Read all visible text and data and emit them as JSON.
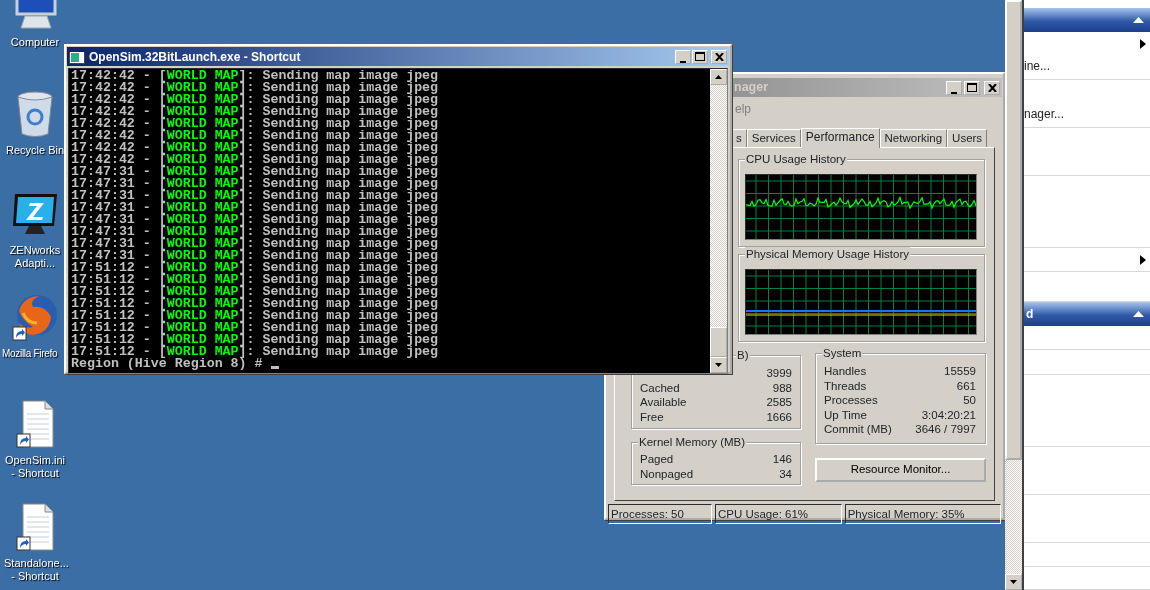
{
  "desktop_icons": [
    {
      "kind": "computer",
      "label": "Computer"
    },
    {
      "kind": "recycle-bin",
      "label": "Recycle Bin"
    },
    {
      "kind": "monitor",
      "label": "ZENworks Adapti..."
    },
    {
      "kind": "globe",
      "label": "Mozilla Firefo"
    },
    {
      "kind": "document",
      "label": "OpenSim.ini - Shortcut"
    },
    {
      "kind": "document",
      "label": "Standalone... - Shortcut"
    }
  ],
  "console": {
    "title": "OpenSim.32BitLaunch.exe - Shortcut",
    "lines": [
      {
        "prefix": "17:42:42 - [",
        "tag": "WORLD MAP",
        "suffix": "]: Sending map image jpeg"
      },
      {
        "prefix": "17:42:42 - [",
        "tag": "WORLD MAP",
        "suffix": "]: Sending map image jpeg"
      },
      {
        "prefix": "17:42:42 - [",
        "tag": "WORLD MAP",
        "suffix": "]: Sending map image jpeg"
      },
      {
        "prefix": "17:42:42 - [",
        "tag": "WORLD MAP",
        "suffix": "]: Sending map image jpeg"
      },
      {
        "prefix": "17:42:42 - [",
        "tag": "WORLD MAP",
        "suffix": "]: Sending map image jpeg"
      },
      {
        "prefix": "17:42:42 - [",
        "tag": "WORLD MAP",
        "suffix": "]: Sending map image jpeg"
      },
      {
        "prefix": "17:42:42 - [",
        "tag": "WORLD MAP",
        "suffix": "]: Sending map image jpeg"
      },
      {
        "prefix": "17:42:42 - [",
        "tag": "WORLD MAP",
        "suffix": "]: Sending map image jpeg"
      },
      {
        "prefix": "17:47:31 - [",
        "tag": "WORLD MAP",
        "suffix": "]: Sending map image jpeg"
      },
      {
        "prefix": "17:47:31 - [",
        "tag": "WORLD MAP",
        "suffix": "]: Sending map image jpeg"
      },
      {
        "prefix": "17:47:31 - [",
        "tag": "WORLD MAP",
        "suffix": "]: Sending map image jpeg"
      },
      {
        "prefix": "17:47:31 - [",
        "tag": "WORLD MAP",
        "suffix": "]: Sending map image jpeg"
      },
      {
        "prefix": "17:47:31 - [",
        "tag": "WORLD MAP",
        "suffix": "]: Sending map image jpeg"
      },
      {
        "prefix": "17:47:31 - [",
        "tag": "WORLD MAP",
        "suffix": "]: Sending map image jpeg"
      },
      {
        "prefix": "17:47:31 - [",
        "tag": "WORLD MAP",
        "suffix": "]: Sending map image jpeg"
      },
      {
        "prefix": "17:47:31 - [",
        "tag": "WORLD MAP",
        "suffix": "]: Sending map image jpeg"
      },
      {
        "prefix": "17:51:12 - [",
        "tag": "WORLD MAP",
        "suffix": "]: Sending map image jpeg"
      },
      {
        "prefix": "17:51:12 - [",
        "tag": "WORLD MAP",
        "suffix": "]: Sending map image jpeg"
      },
      {
        "prefix": "17:51:12 - [",
        "tag": "WORLD MAP",
        "suffix": "]: Sending map image jpeg"
      },
      {
        "prefix": "17:51:12 - [",
        "tag": "WORLD MAP",
        "suffix": "]: Sending map image jpeg"
      },
      {
        "prefix": "17:51:12 - [",
        "tag": "WORLD MAP",
        "suffix": "]: Sending map image jpeg"
      },
      {
        "prefix": "17:51:12 - [",
        "tag": "WORLD MAP",
        "suffix": "]: Sending map image jpeg"
      },
      {
        "prefix": "17:51:12 - [",
        "tag": "WORLD MAP",
        "suffix": "]: Sending map image jpeg"
      },
      {
        "prefix": "17:51:12 - [",
        "tag": "WORLD MAP",
        "suffix": "]: Sending map image jpeg"
      }
    ],
    "prompt": "Region (Hive Region 8) #"
  },
  "task_manager": {
    "title": "nager",
    "menu": [
      "elp"
    ],
    "tabs": [
      {
        "label": "s",
        "selected": false
      },
      {
        "label": "Services",
        "selected": false
      },
      {
        "label": "Performance",
        "selected": true
      },
      {
        "label": "Networking",
        "selected": false
      },
      {
        "label": "Users",
        "selected": false
      }
    ],
    "cpu_group": {
      "title": "CPU Usage History"
    },
    "memory_group": {
      "title": "Physical Memory Usage History"
    },
    "physical_memory": {
      "title": "B)",
      "rows": [
        {
          "value": "3999"
        },
        {
          "label": "Cached",
          "value": "988"
        },
        {
          "label": "Available",
          "value": "2585"
        },
        {
          "label": "Free",
          "value": "1666"
        }
      ]
    },
    "kernel_memory": {
      "title": "Kernel Memory (MB)",
      "rows": [
        {
          "label": "Paged",
          "value": "146"
        },
        {
          "label": "Nonpaged",
          "value": "34"
        }
      ]
    },
    "system": {
      "title": "System",
      "rows": [
        {
          "label": "Handles",
          "value": "15559"
        },
        {
          "label": "Threads",
          "value": "661"
        },
        {
          "label": "Processes",
          "value": "50"
        },
        {
          "label": "Up Time",
          "value": "3:04:20:21"
        },
        {
          "label": "Commit (MB)",
          "value": "3646 / 7997"
        }
      ]
    },
    "resource_button": "Resource Monitor...",
    "status_bar": [
      "Processes: 50",
      "CPU Usage: 61%",
      "Physical Memory: 35%"
    ]
  },
  "side_panel": {
    "sections": [
      {
        "items": [
          {
            "label": "ine...",
            "submenu": true
          },
          {
            "label": "nager...",
            "submenu": false
          },
          {
            "submenu": false
          },
          {
            "submenu": false
          },
          {
            "submenu": true
          },
          {
            "submenu": false
          }
        ]
      },
      {
        "title": "d",
        "items": [
          {
            "submenu": false
          },
          {
            "submenu": false
          },
          {
            "submenu": false
          },
          {
            "submenu": false
          },
          {
            "submenu": false
          },
          {
            "submenu": false
          },
          {
            "submenu": false
          }
        ]
      }
    ]
  }
}
